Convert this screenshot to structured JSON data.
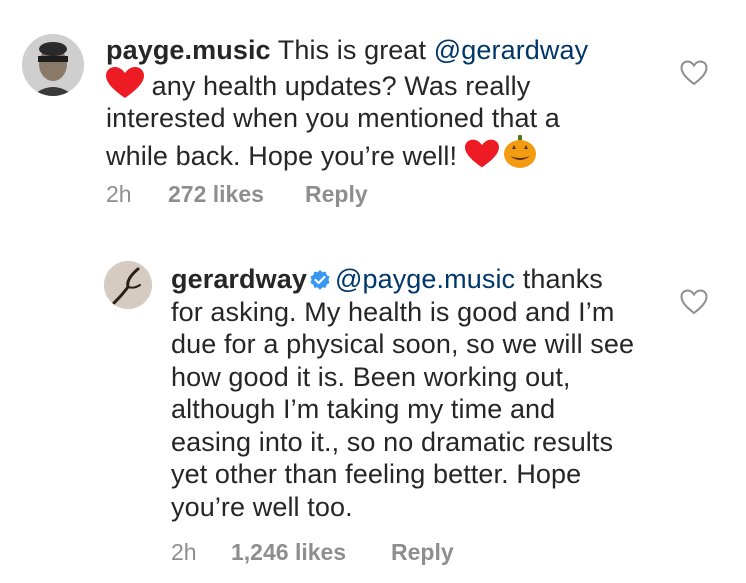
{
  "comments": [
    {
      "username": "payge.music",
      "text_part1": " This is great ",
      "mention": "@gerardway",
      "text_part2": " any health updates? Was really interested when you mentioned that a while back. Hope you’re well! ",
      "emoji_1": "heart",
      "emoji_2": "heart",
      "emoji_3": "jack-o-lantern",
      "time": "2h",
      "likes": "272 likes",
      "reply": "Reply",
      "like_icon": "heart-outline-icon",
      "colors": {
        "heart": "#ed1c24",
        "pumpkin": "#f39c12"
      }
    },
    {
      "username": "gerardway",
      "verified": true,
      "mention": "@payge.music",
      "text": " thanks for asking. My health is good and I’m due for a physical soon, so we will see how good it is. Been working out, although I’m taking my time and easing into it., so no dramatic results yet other than feeling better. Hope you’re well too.",
      "time": "2h",
      "likes": "1,246 likes",
      "reply": "Reply",
      "like_icon": "heart-outline-icon",
      "colors": {
        "verified": "#3897f0",
        "mention": "#00376b"
      }
    }
  ]
}
